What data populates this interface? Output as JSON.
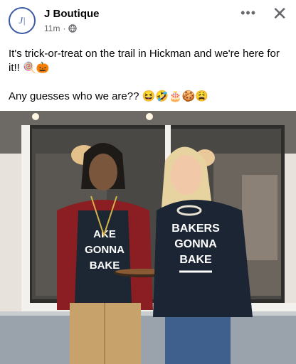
{
  "post": {
    "page_name": "J Boutique",
    "time": "11m",
    "privacy_icon": "globe-icon",
    "more_icon": "more-icon",
    "close_icon": "close-icon",
    "line1": "It's trick-or-treat on the trail in Hickman and we're here for it!! 🍭🎃",
    "line2": "Any guesses who we are?? 😆🤣🎂🍪😩"
  },
  "photo": {
    "shirt_left": [
      "AKE",
      "GONNA",
      "BAKE"
    ],
    "shirt_right": [
      "BAKERS",
      "GONNA",
      "BAKE"
    ]
  }
}
